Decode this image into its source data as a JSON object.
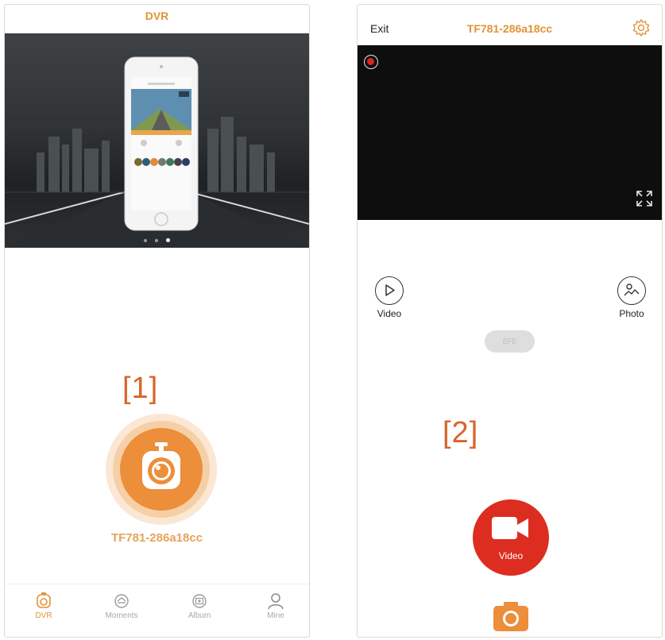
{
  "left": {
    "title": "DVR",
    "banner_dots": 3,
    "active_dot": 2,
    "ref_label": "[1]",
    "device_name": "TF781-286a18cc",
    "tabs": [
      {
        "label": "DVR",
        "icon": "dvr-icon",
        "active": true
      },
      {
        "label": "Moments",
        "icon": "moments-icon",
        "active": false
      },
      {
        "label": "Album",
        "icon": "album-icon",
        "active": false
      },
      {
        "label": "Mine",
        "icon": "person-icon",
        "active": false
      }
    ]
  },
  "right": {
    "exit_label": "Exit",
    "title": "TF781-286a18cc",
    "settings_icon": "gear-icon",
    "video_label": "Video",
    "photo_label": "Photo",
    "pill_label": "EFE",
    "ref_label": "[2]",
    "record_label": "Video"
  },
  "colors": {
    "accent_orange": "#e09436",
    "dvr_button": "#ec8e3a",
    "record_red": "#dd2d20",
    "ref_label": "#d9652a"
  }
}
